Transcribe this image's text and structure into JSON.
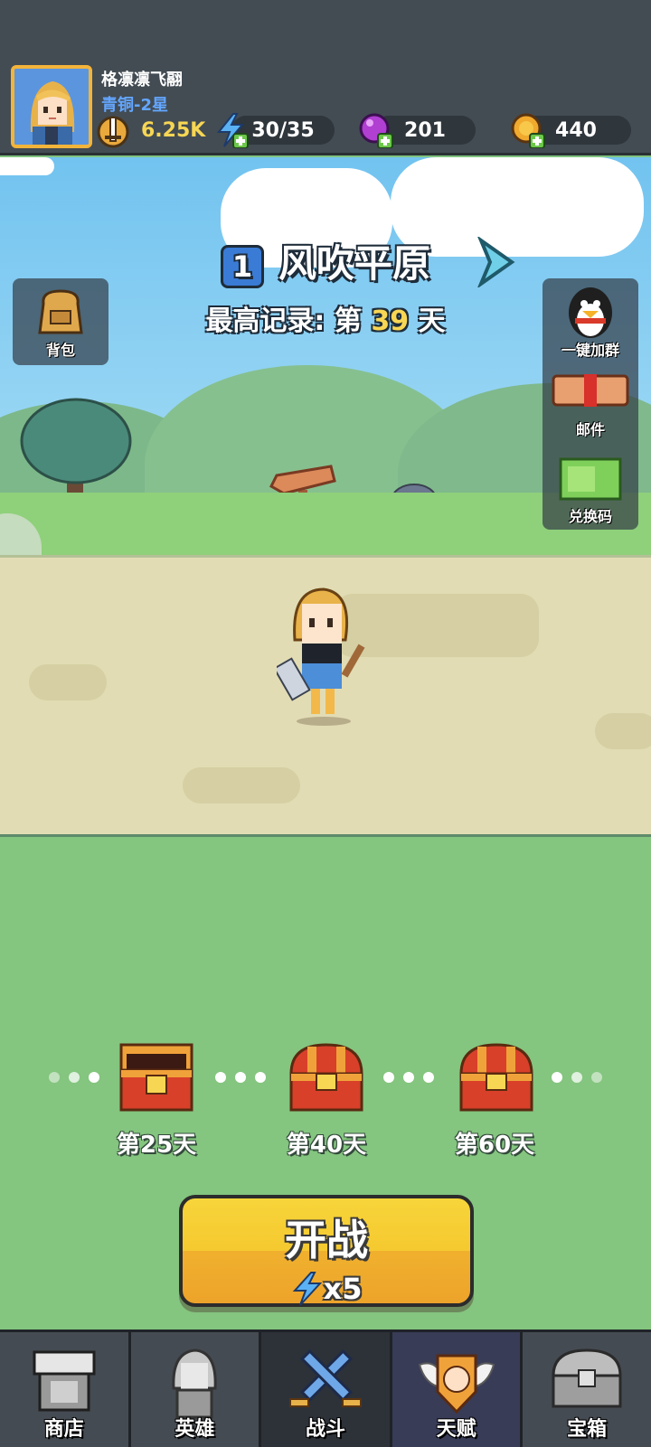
{
  "player": {
    "name": "格凛凛飞翮",
    "rank": "青铜-2星"
  },
  "resources": {
    "power": "6.25K",
    "energy": "30/35",
    "gems": "201",
    "coins": "440"
  },
  "stage": {
    "number": "1",
    "name": "风吹平原",
    "best_prefix": "最高记录: 第",
    "best_day": "39",
    "best_suffix": "天"
  },
  "side": {
    "backpack": "背包",
    "join_group": "一键加群",
    "mail": "邮件",
    "redeem": "兑换码"
  },
  "milestones": [
    {
      "label": "第25天",
      "state": "open"
    },
    {
      "label": "第40天",
      "state": "closed"
    },
    {
      "label": "第60天",
      "state": "closed"
    }
  ],
  "start_button": {
    "title": "开战",
    "cost": "x5"
  },
  "nav": {
    "shop": "商店",
    "heroes": "英雄",
    "battle": "战斗",
    "talent": "天赋",
    "chest": "宝箱"
  },
  "icons": {
    "power": "sword-power-icon",
    "energy": "lightning-icon",
    "gems": "gem-icon",
    "coins": "coin-icon"
  },
  "colors": {
    "top_bar": "#434c53",
    "accent_yellow": "#f7d654",
    "rank_blue": "#63a6ff",
    "start_button": "#f5c930",
    "field_green": "#84c57f"
  }
}
